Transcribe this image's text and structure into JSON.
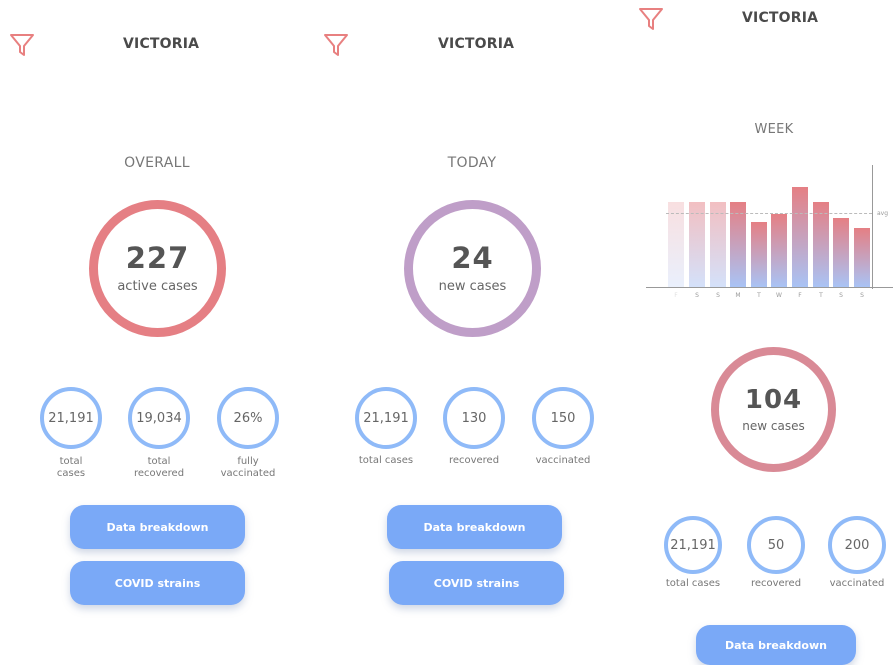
{
  "panels": [
    {
      "region": "VICTORIA",
      "heading": "OVERALL",
      "big_value": "227",
      "big_caption": "active cases",
      "stats": [
        {
          "value": "21,191",
          "label_line1": "total",
          "label_line2": "cases"
        },
        {
          "value": "19,034",
          "label_line1": "total",
          "label_line2": "recovered"
        },
        {
          "value": "26%",
          "label_line1": "fully",
          "label_line2": "vaccinated"
        }
      ],
      "buttons": [
        "Data breakdown",
        "COVID strains"
      ]
    },
    {
      "region": "VICTORIA",
      "heading": "TODAY",
      "big_value": "24",
      "big_caption": "new cases",
      "stats": [
        {
          "value": "21,191",
          "label": "total cases"
        },
        {
          "value": "130",
          "label": "recovered"
        },
        {
          "value": "150",
          "label": "vaccinated"
        }
      ],
      "buttons": [
        "Data breakdown",
        "COVID strains"
      ]
    },
    {
      "region": "VICTORIA",
      "heading": "WEEK",
      "big_value": "104",
      "big_caption": "new cases",
      "stats": [
        {
          "value": "21,191",
          "label": "total cases"
        },
        {
          "value": "50",
          "label": "recovered"
        },
        {
          "value": "200",
          "label": "vaccinated"
        }
      ],
      "buttons": [
        "Data breakdown"
      ]
    }
  ],
  "chart_data": {
    "type": "bar",
    "categories": [
      "F",
      "S",
      "S",
      "M",
      "T",
      "W",
      "F",
      "T",
      "S",
      "S"
    ],
    "values": [
      84,
      84,
      84,
      84,
      64,
      72,
      98,
      84,
      68,
      58
    ],
    "avg_value": 73,
    "avg_label": "avg",
    "ylim": [
      0,
      120
    ]
  },
  "colors": {
    "filter_icon": "#e88080",
    "overall_ring": "#e57f84",
    "today_ring": "#bf9ec8",
    "week_ring": "#d98a96",
    "stat_ring": "#8fbaf8",
    "button": "#7aa9f7",
    "bar_top": "#e57f84",
    "bar_bottom": "#a9c3f5"
  }
}
